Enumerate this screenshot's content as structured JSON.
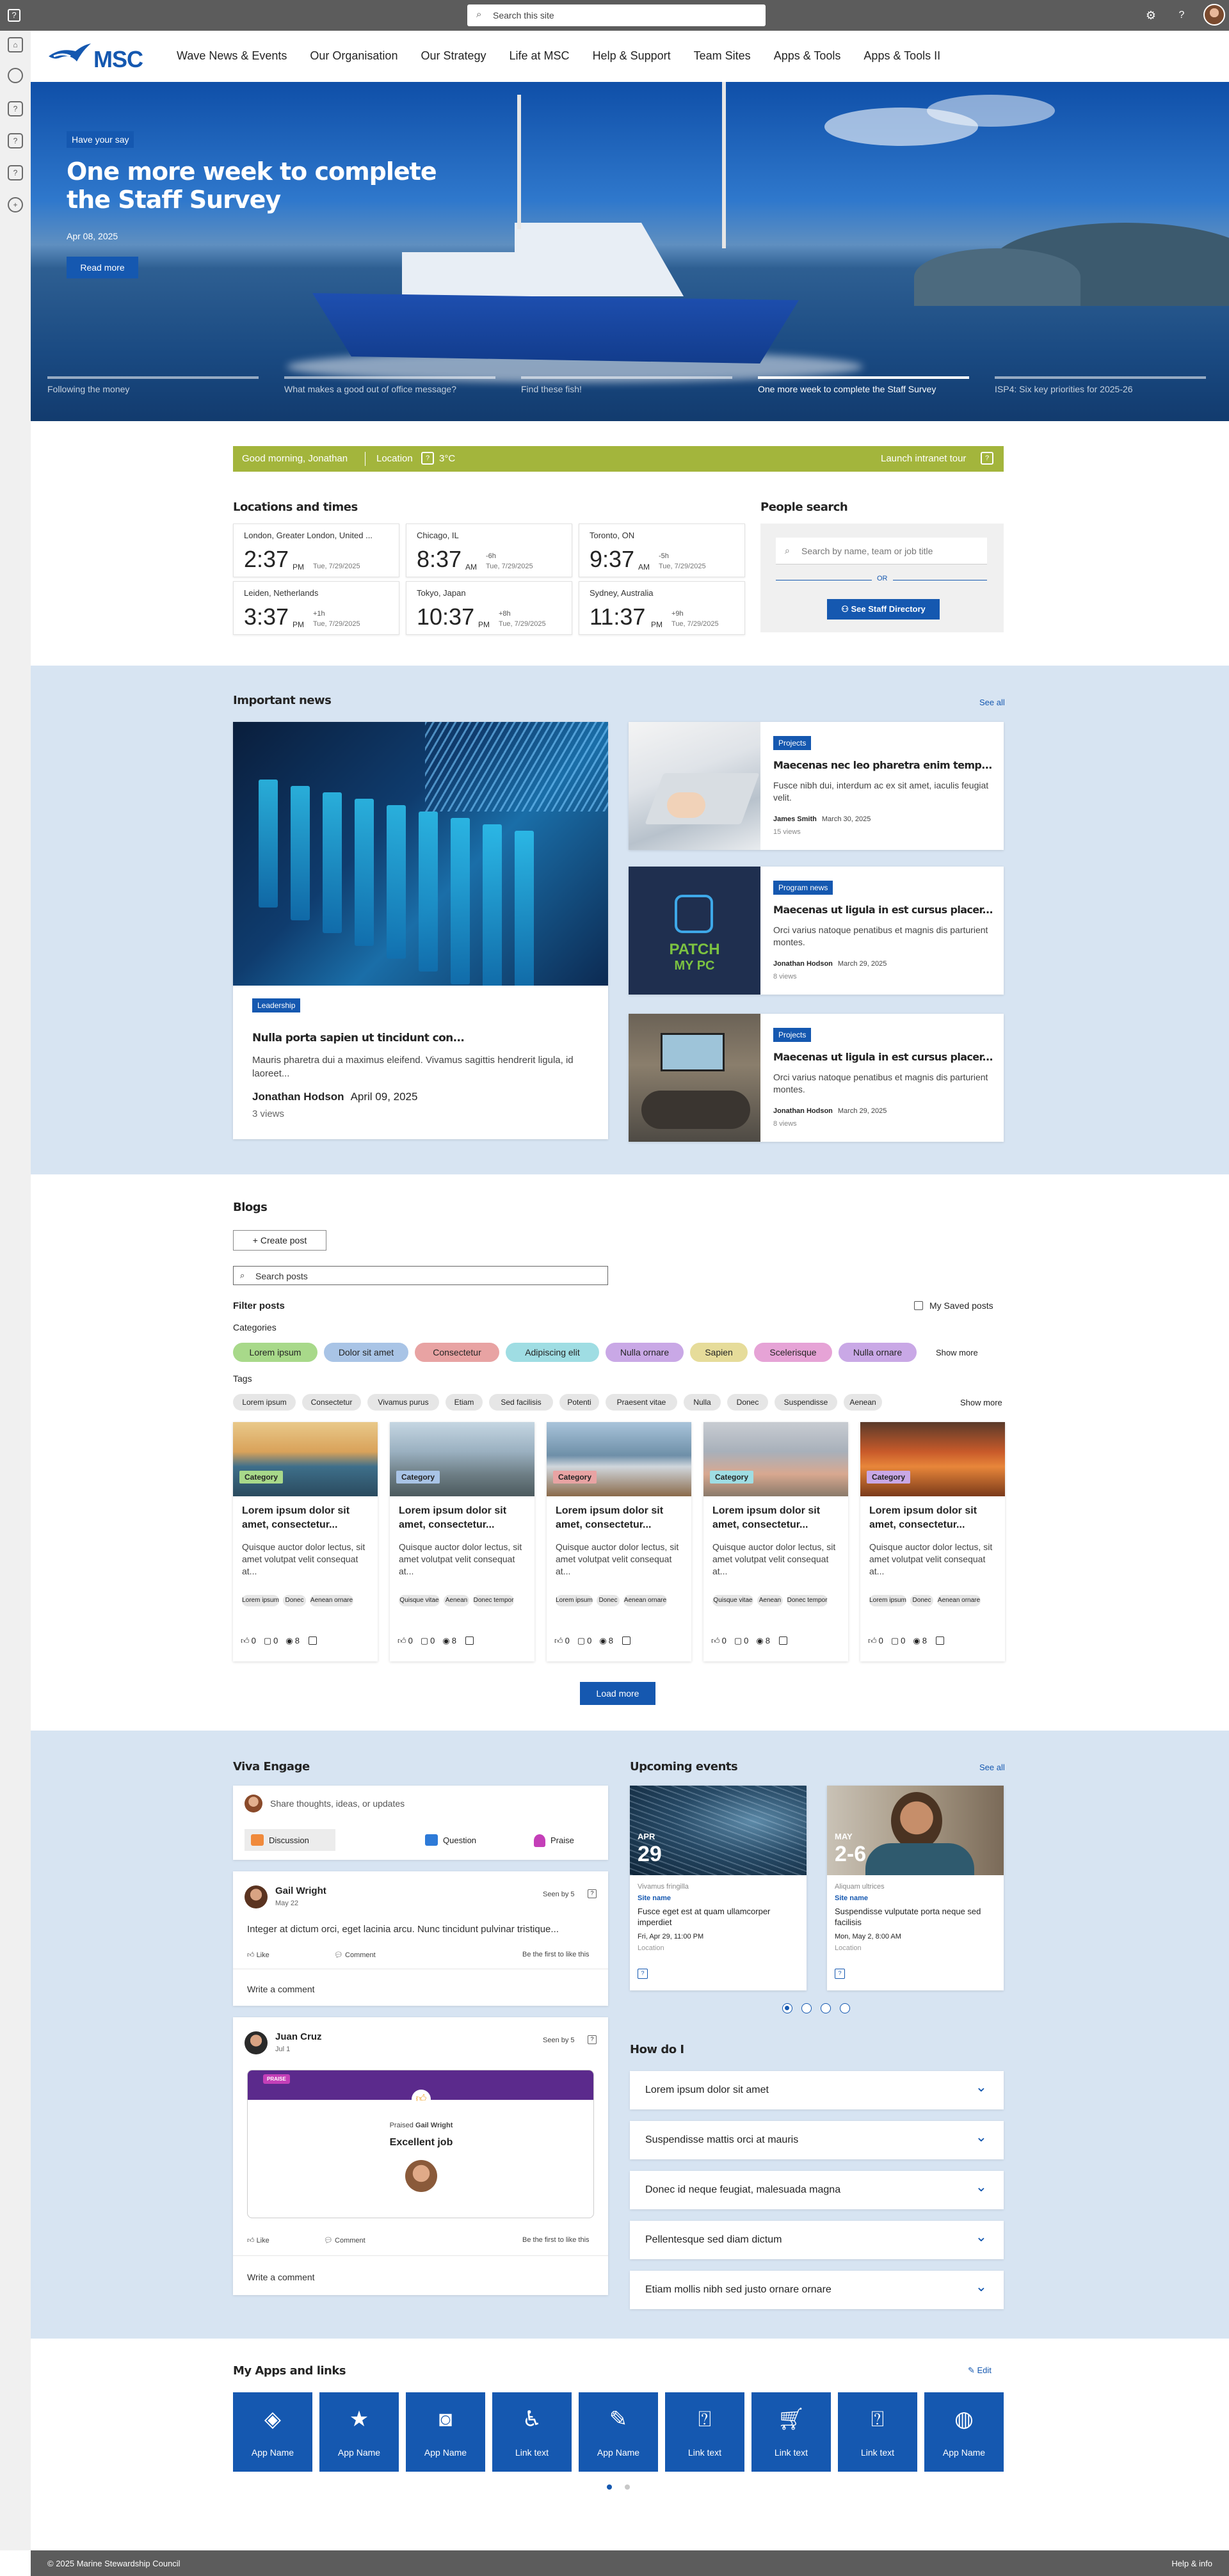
{
  "topbar": {
    "search_placeholder": "Search this site",
    "app_icon": "question-icon",
    "settings_icon": "gear-icon",
    "help_icon": "help-icon"
  },
  "brand": {
    "logo_text": "MSC",
    "accent": "#1558b0",
    "green": "#a3b53c"
  },
  "nav": [
    "Wave News & Events",
    "Our Organisation",
    "Our Strategy",
    "Life at MSC",
    "Help & Support",
    "Team Sites",
    "Apps & Tools",
    "Apps & Tools II"
  ],
  "hero": {
    "badge": "Have your say",
    "title": "One more week to complete the Staff Survey",
    "date": "Apr 08, 2025",
    "button": "Read more",
    "tabs": [
      "Following the money",
      "What makes a good out of office message?",
      "Find these fish!",
      "One more week to complete the Staff Survey",
      "ISP4: Six key priorities for 2025-26"
    ],
    "active_tab": 3
  },
  "greeting": {
    "text": "Good morning, Jonathan",
    "location_label": "Location",
    "temperature": "3°C",
    "tour": "Launch intranet tour"
  },
  "locations": {
    "title": "Locations and times",
    "clocks": [
      {
        "city": "London, Greater London, United ...",
        "time": "2:37",
        "ampm": "PM",
        "offset": "",
        "date": "Tue, 7/29/2025"
      },
      {
        "city": "Chicago, IL",
        "time": "8:37",
        "ampm": "AM",
        "offset": "-6h",
        "date": "Tue, 7/29/2025"
      },
      {
        "city": "Toronto, ON",
        "time": "9:37",
        "ampm": "AM",
        "offset": "-5h",
        "date": "Tue, 7/29/2025"
      },
      {
        "city": "Leiden, Netherlands",
        "time": "3:37",
        "ampm": "PM",
        "offset": "+1h",
        "date": "Tue, 7/29/2025"
      },
      {
        "city": "Tokyo, Japan",
        "time": "10:37",
        "ampm": "PM",
        "offset": "+8h",
        "date": "Tue, 7/29/2025"
      },
      {
        "city": "Sydney, Australia",
        "time": "11:37",
        "ampm": "PM",
        "offset": "+9h",
        "date": "Tue, 7/29/2025"
      }
    ]
  },
  "people": {
    "title": "People search",
    "placeholder": "Search by name, team or job title",
    "or": "OR",
    "button": "See Staff Directory"
  },
  "news": {
    "title": "Important news",
    "see_all": "See all",
    "main": {
      "tag": "Leadership",
      "title": "Nulla porta sapien ut tincidunt con...",
      "desc": "Mauris pharetra dui a maximus eleifend. Vivamus sagittis hendrerit ligula, id laoreet...",
      "author": "Jonathan Hodson",
      "date": "April 09, 2025",
      "views": "3 views"
    },
    "items": [
      {
        "tag": "Projects",
        "title": "Maecenas nec leo pharetra enim temp...",
        "desc": "Fusce nibh dui, interdum ac ex sit amet, iaculis feugiat velit.",
        "author": "James Smith",
        "date": "March 30, 2025",
        "views": "15 views"
      },
      {
        "tag": "Program news",
        "title": "Maecenas ut ligula in est cursus placer...",
        "desc": "Orci varius natoque penatibus et magnis dis parturient montes.",
        "author": "Jonathan Hodson",
        "date": "March 29, 2025",
        "views": "8 views"
      },
      {
        "tag": "Projects",
        "title": "Maecenas ut ligula in est cursus placer...",
        "desc": "Orci varius natoque penatibus et magnis dis parturient montes.",
        "author": "Jonathan Hodson",
        "date": "March 29, 2025",
        "views": "8 views"
      }
    ],
    "patch_text_1": "PATCH",
    "patch_text_2": "MY PC"
  },
  "blogs": {
    "title": "Blogs",
    "create": "Create post",
    "search_placeholder": "Search posts",
    "filter": "Filter posts",
    "saved": "My Saved posts",
    "categories_label": "Categories",
    "categories": [
      {
        "name": "Lorem ipsum",
        "color": "#a8d98a"
      },
      {
        "name": "Dolor sit amet",
        "color": "#a9c4e6"
      },
      {
        "name": "Consectetur",
        "color": "#e8a3a3"
      },
      {
        "name": "Adipiscing elit",
        "color": "#9fdde3"
      },
      {
        "name": "Nulla ornare",
        "color": "#c9a8e6"
      },
      {
        "name": "Sapien",
        "color": "#e6dc9a"
      },
      {
        "name": "Scelerisque",
        "color": "#e6a3d6"
      },
      {
        "name": "Nulla ornare",
        "color": "#c9a8e6"
      }
    ],
    "show_more": "Show more",
    "tags_label": "Tags",
    "tags": [
      "Lorem ipsum",
      "Consectetur",
      "Vivamus purus",
      "Etiam",
      "Sed facilisis",
      "Potenti",
      "Praesent vitae",
      "Nulla",
      "Donec",
      "Suspendisse",
      "Aenean"
    ],
    "posts": [
      {
        "category": "Category",
        "cat_color": "#a8d98a",
        "title": "Lorem ipsum dolor sit amet, consectetur...",
        "desc": "Quisque auctor dolor lectus, sit amet volutpat velit consequat at...",
        "tags": [
          "Lorem ipsum",
          "Donec",
          "Aenean ornare"
        ],
        "likes": "0",
        "comments": "0",
        "views": "8"
      },
      {
        "category": "Category",
        "cat_color": "#a9c4e6",
        "title": "Lorem ipsum dolor sit amet, consectetur...",
        "desc": "Quisque auctor dolor lectus, sit amet volutpat velit consequat at...",
        "tags": [
          "Quisque vitae",
          "Aenean",
          "Donec tempor"
        ],
        "likes": "0",
        "comments": "0",
        "views": "8"
      },
      {
        "category": "Category",
        "cat_color": "#e8a3a3",
        "title": "Lorem ipsum dolor sit amet, consectetur...",
        "desc": "Quisque auctor dolor lectus, sit amet volutpat velit consequat at...",
        "tags": [
          "Lorem ipsum",
          "Donec",
          "Aenean ornare"
        ],
        "likes": "0",
        "comments": "0",
        "views": "8"
      },
      {
        "category": "Category",
        "cat_color": "#9fdde3",
        "title": "Lorem ipsum dolor sit amet, consectetur...",
        "desc": "Quisque auctor dolor lectus, sit amet volutpat velit consequat at...",
        "tags": [
          "Quisque vitae",
          "Aenean",
          "Donec tempor"
        ],
        "likes": "0",
        "comments": "0",
        "views": "8"
      },
      {
        "category": "Category",
        "cat_color": "#c9a8e6",
        "title": "Lorem ipsum dolor sit amet, consectetur...",
        "desc": "Quisque auctor dolor lectus, sit amet volutpat velit consequat at...",
        "tags": [
          "Lorem ipsum",
          "Donec",
          "Aenean ornare"
        ],
        "likes": "0",
        "comments": "0",
        "views": "8"
      }
    ],
    "load_more": "Load more"
  },
  "engage": {
    "title": "Viva Engage",
    "prompt": "Share thoughts, ideas, or updates",
    "actions": [
      "Discussion",
      "Question",
      "Praise"
    ],
    "posts": [
      {
        "name": "Gail Wright",
        "date": "May 22",
        "seen": "Seen by 5",
        "text": "Integer at dictum orci, eget lacinia arcu. Nunc tincidunt pulvinar tristique...",
        "like": "Like",
        "comment": "Comment",
        "first": "Be the first to like this",
        "write": "Write a comment"
      },
      {
        "name": "Juan Cruz",
        "date": "Jul 1",
        "seen": "Seen by 5",
        "praise_badge": "PRAISE",
        "praised_prefix": "Praised",
        "praised_name": "Gail Wright",
        "praise_title": "Excellent job",
        "like": "Like",
        "comment": "Comment",
        "first": "Be the first to like this",
        "write": "Write a comment"
      }
    ]
  },
  "events": {
    "title": "Upcoming events",
    "see_all": "See all",
    "items": [
      {
        "month": "APR",
        "day": "29",
        "org": "Vivamus fringilla",
        "site": "Site name",
        "title": "Fusce eget est at quam ullamcorper imperdiet",
        "when": "Fri, Apr 29, 11:00 PM",
        "location": "Location"
      },
      {
        "month": "MAY",
        "day": "2-6",
        "org": "Aliquam ultrices",
        "site": "Site name",
        "title": "Suspendisse vulputate porta neque sed facilisis",
        "when": "Mon, May 2, 8:00 AM",
        "location": "Location"
      }
    ],
    "pages": 4,
    "active_page": 0
  },
  "howdoi": {
    "title": "How do I",
    "items": [
      "Lorem ipsum dolor sit amet",
      "Suspendisse mattis orci at mauris",
      "Donec id neque feugiat, malesuada magna",
      "Pellentesque sed diam dictum",
      "Etiam mollis nibh sed justo ornare ornare"
    ]
  },
  "apps": {
    "title": "My Apps and links",
    "edit": "Edit",
    "items": [
      {
        "name": "App Name",
        "icon": "diamond-icon"
      },
      {
        "name": "App Name",
        "icon": "star-icon"
      },
      {
        "name": "App Name",
        "icon": "camera-icon"
      },
      {
        "name": "Link text",
        "icon": "accessibility-icon"
      },
      {
        "name": "App Name",
        "icon": "pen-icon"
      },
      {
        "name": "Link text",
        "icon": "question-icon"
      },
      {
        "name": "Link text",
        "icon": "cart-icon"
      },
      {
        "name": "Link text",
        "icon": "question-icon"
      },
      {
        "name": "App Name",
        "icon": "globe-icon"
      }
    ]
  },
  "footer": {
    "copyright": "© 2025 Marine Stewardship Council",
    "help": "Help & info"
  }
}
